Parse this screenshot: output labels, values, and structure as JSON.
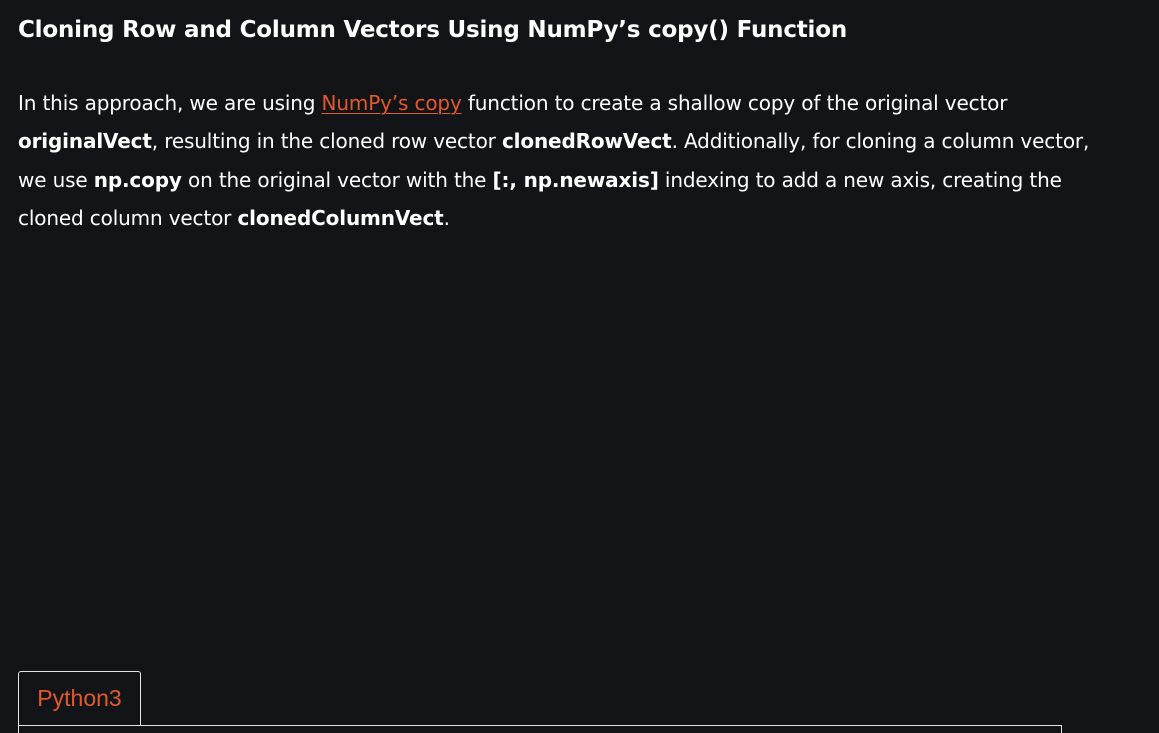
{
  "article": {
    "heading": "Cloning Row and Column Vectors Using NumPy’s copy() Function",
    "paragraph": {
      "t1": "In this approach, we are using ",
      "link": "NumPy’s copy",
      "t2": " function to create a shallow copy of the original vector ",
      "b1": "originalVect",
      "t3": ", resulting in the cloned row vector ",
      "b2": "clonedRowVect",
      "t4": ". Additionally, for cloning a column vector, we use ",
      "b3": "np.copy",
      "t5": " on the original vector with the ",
      "b4": "[:, np.newaxis]",
      "t6": " indexing to add a new axis, creating the cloned column vector ",
      "b5": "clonedColumnVect",
      "t7": "."
    }
  },
  "code_tabs": {
    "active_tab": "Python3"
  },
  "colors": {
    "background": "#131417",
    "text": "#ffffff",
    "accent": "#e25a2c",
    "border": "#e6e6e6"
  }
}
